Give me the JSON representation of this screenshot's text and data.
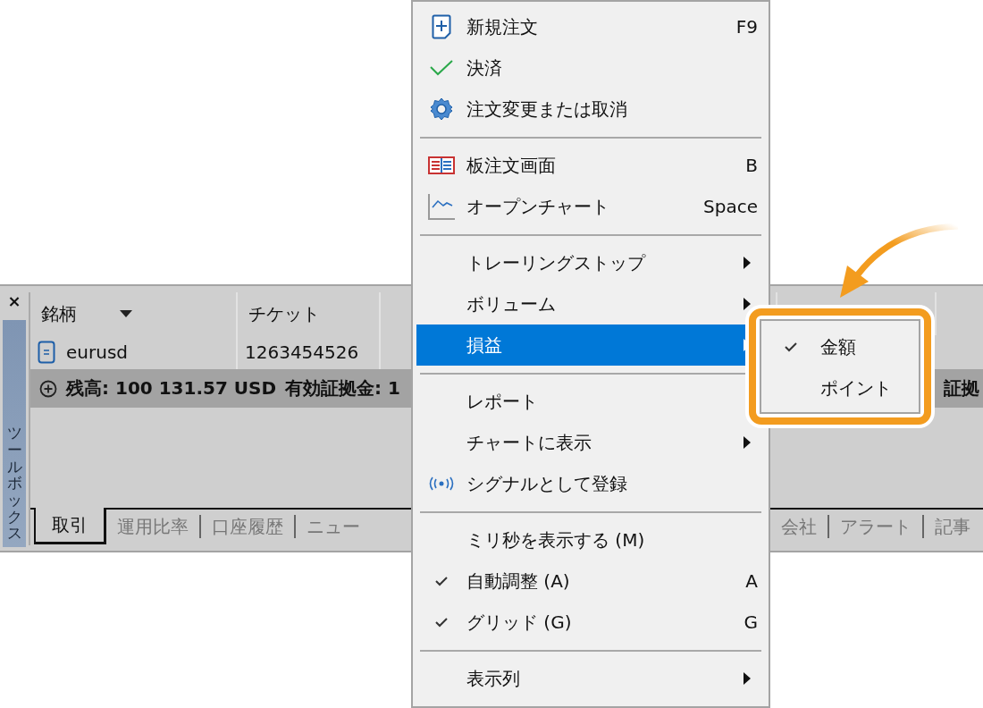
{
  "toolbox": {
    "close": "×",
    "title": "ツールボックス"
  },
  "table": {
    "columns": [
      {
        "label": "銘柄",
        "sorted": true
      },
      {
        "label": "チケット",
        "sorted": false
      }
    ],
    "rows": [
      {
        "symbol": "eurusd",
        "ticket": "1263454526"
      }
    ]
  },
  "summary": {
    "balance": "残高: 100 131.57 USD",
    "equity": "有効証拠金: 1",
    "right": "証拠"
  },
  "tabs_left": [
    {
      "label": "取引",
      "selected": true
    },
    {
      "label": "運用比率",
      "selected": false
    },
    {
      "label": "口座履歴",
      "selected": false
    },
    {
      "label": "ニュー",
      "selected": false
    }
  ],
  "tabs_right": [
    {
      "label": "会社",
      "selected": false
    },
    {
      "label": "アラート",
      "selected": false
    },
    {
      "label": "記事",
      "selected": false
    }
  ],
  "context_menu": {
    "items": [
      {
        "kind": "item",
        "label": "新規注文",
        "shortcut": "F9",
        "checked": false,
        "submenu": false,
        "selected": false
      },
      {
        "kind": "item",
        "label": "決済",
        "checked": false,
        "submenu": false,
        "selected": false
      },
      {
        "kind": "item",
        "label": "注文変更または取消",
        "checked": false,
        "submenu": false,
        "selected": false
      },
      {
        "kind": "separator"
      },
      {
        "kind": "item",
        "label": "板注文画面",
        "shortcut": "B",
        "checked": false,
        "submenu": false,
        "selected": false
      },
      {
        "kind": "item",
        "label": "オープンチャート",
        "shortcut": "Space",
        "checked": false,
        "submenu": false,
        "selected": false
      },
      {
        "kind": "separator"
      },
      {
        "kind": "item",
        "label": "トレーリングストップ",
        "checked": false,
        "submenu": true,
        "selected": false
      },
      {
        "kind": "item",
        "label": "ボリューム",
        "checked": false,
        "submenu": true,
        "selected": false
      },
      {
        "kind": "item",
        "label": "損益",
        "checked": false,
        "submenu": true,
        "selected": true
      },
      {
        "kind": "separator"
      },
      {
        "kind": "item",
        "label": "レポート",
        "checked": false,
        "submenu": false,
        "selected": false
      },
      {
        "kind": "item",
        "label": "チャートに表示",
        "checked": false,
        "submenu": true,
        "selected": false
      },
      {
        "kind": "item",
        "label": "シグナルとして登録",
        "checked": false,
        "submenu": false,
        "selected": false
      },
      {
        "kind": "separator"
      },
      {
        "kind": "item",
        "label": "ミリ秒を表示する (M)",
        "checked": false,
        "submenu": false,
        "selected": false
      },
      {
        "kind": "item",
        "label": "自動調整 (A)",
        "shortcut": "A",
        "checked": true,
        "submenu": false,
        "selected": false
      },
      {
        "kind": "item",
        "label": "グリッド (G)",
        "shortcut": "G",
        "checked": true,
        "submenu": false,
        "selected": false
      },
      {
        "kind": "separator"
      },
      {
        "kind": "item",
        "label": "表示列",
        "checked": false,
        "submenu": true,
        "selected": false
      }
    ]
  },
  "submenu": {
    "items": [
      {
        "label": "金額",
        "checked": true
      },
      {
        "label": "ポイント",
        "checked": false
      }
    ]
  }
}
